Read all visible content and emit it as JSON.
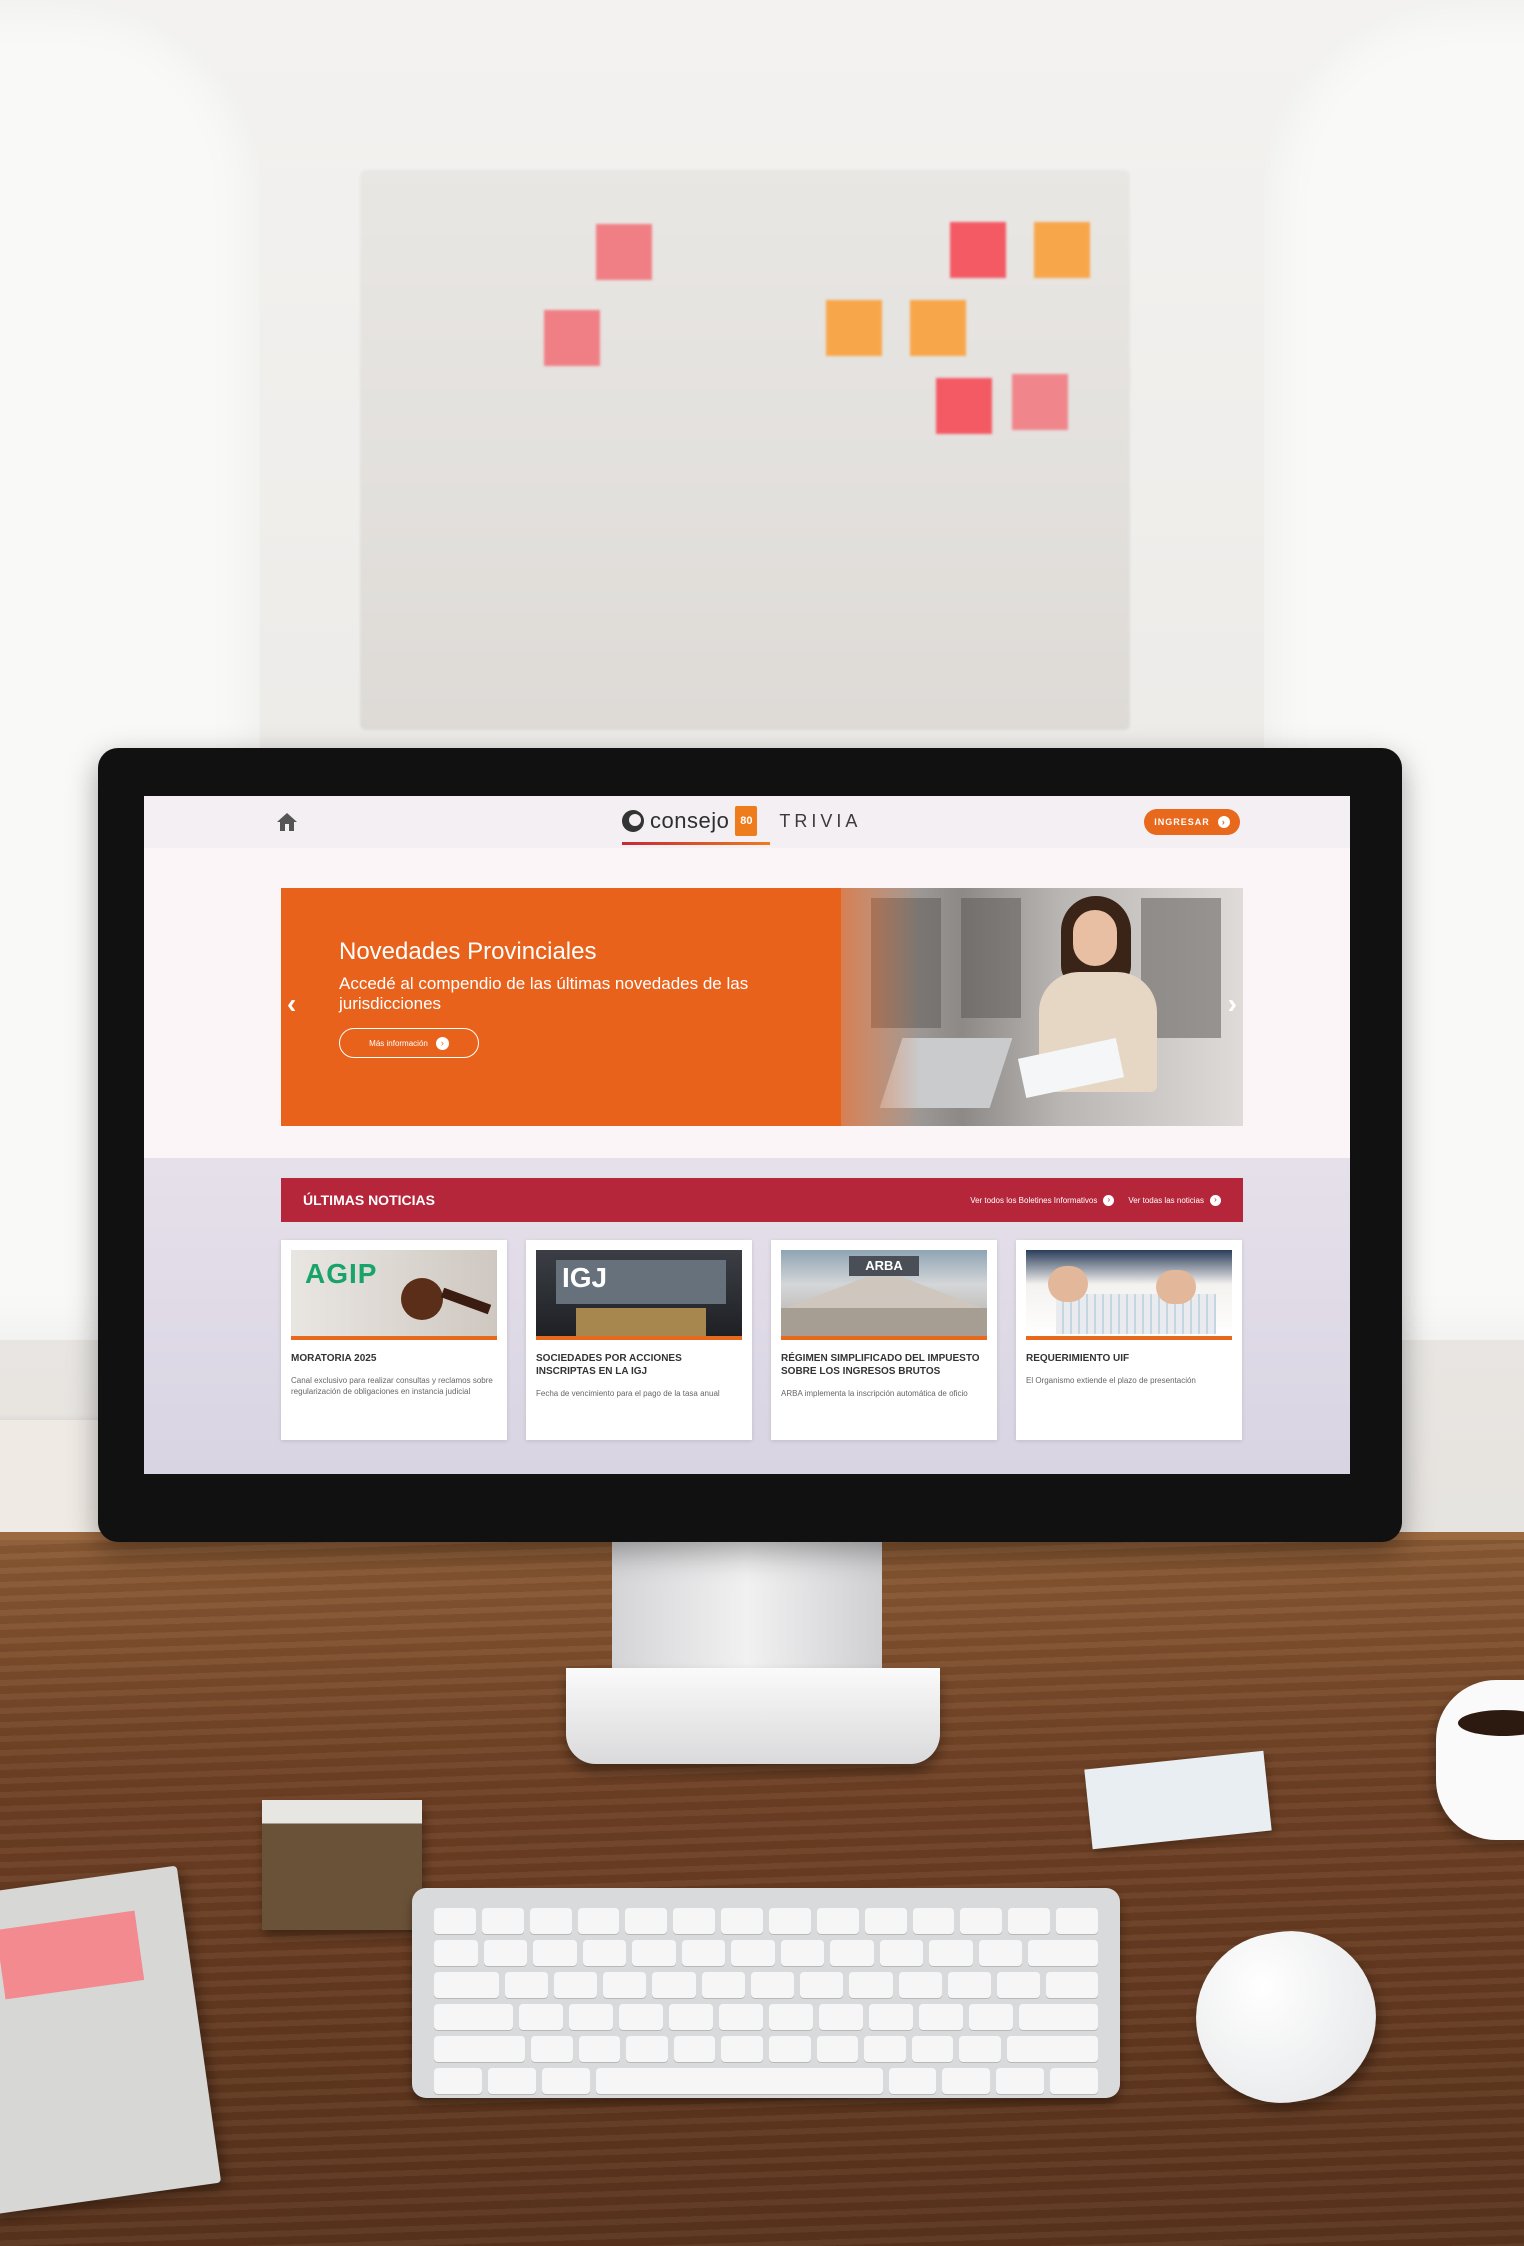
{
  "header": {
    "home_icon": "home-icon",
    "consejo_logo": "consejo",
    "consejo_badge": "80",
    "trivia_logo_main": "TRIVIA",
    "login_label": "INGRESAR"
  },
  "banner": {
    "title": "Novedades Provinciales",
    "subtitle": "Accedé al compendio de las últimas novedades de las jurisdicciones",
    "button_label": "Más información",
    "prev_icon": "chevron-left-icon",
    "next_icon": "chevron-right-icon"
  },
  "news": {
    "section_title": "ÚLTIMAS NOTICIAS",
    "link_boletines": "Ver todos los Boletines Informativos",
    "link_noticias": "Ver todas las noticias",
    "cards": [
      {
        "image_label": "AGIP",
        "title": "MORATORIA 2025",
        "description": "Canal exclusivo para realizar consultas y reclamos sobre regularización de obligaciones en instancia judicial"
      },
      {
        "image_label": "IGJ",
        "title": "SOCIEDADES POR ACCIONES INSCRIPTAS EN LA IGJ",
        "description": "Fecha de vencimiento para el pago de la tasa anual"
      },
      {
        "image_label": "ARBA",
        "title": "RÉGIMEN SIMPLIFICADO DEL IMPUESTO SOBRE LOS INGRESOS BRUTOS",
        "description": "ARBA implementa la inscripción automática de oficio"
      },
      {
        "image_label": "",
        "title": "REQUERIMIENTO UIF",
        "description": "El Organismo extiende el plazo de presentación"
      }
    ]
  },
  "colors": {
    "accent_orange": "#e8681c",
    "news_red": "#b5263a",
    "agip_green": "#17a468"
  }
}
